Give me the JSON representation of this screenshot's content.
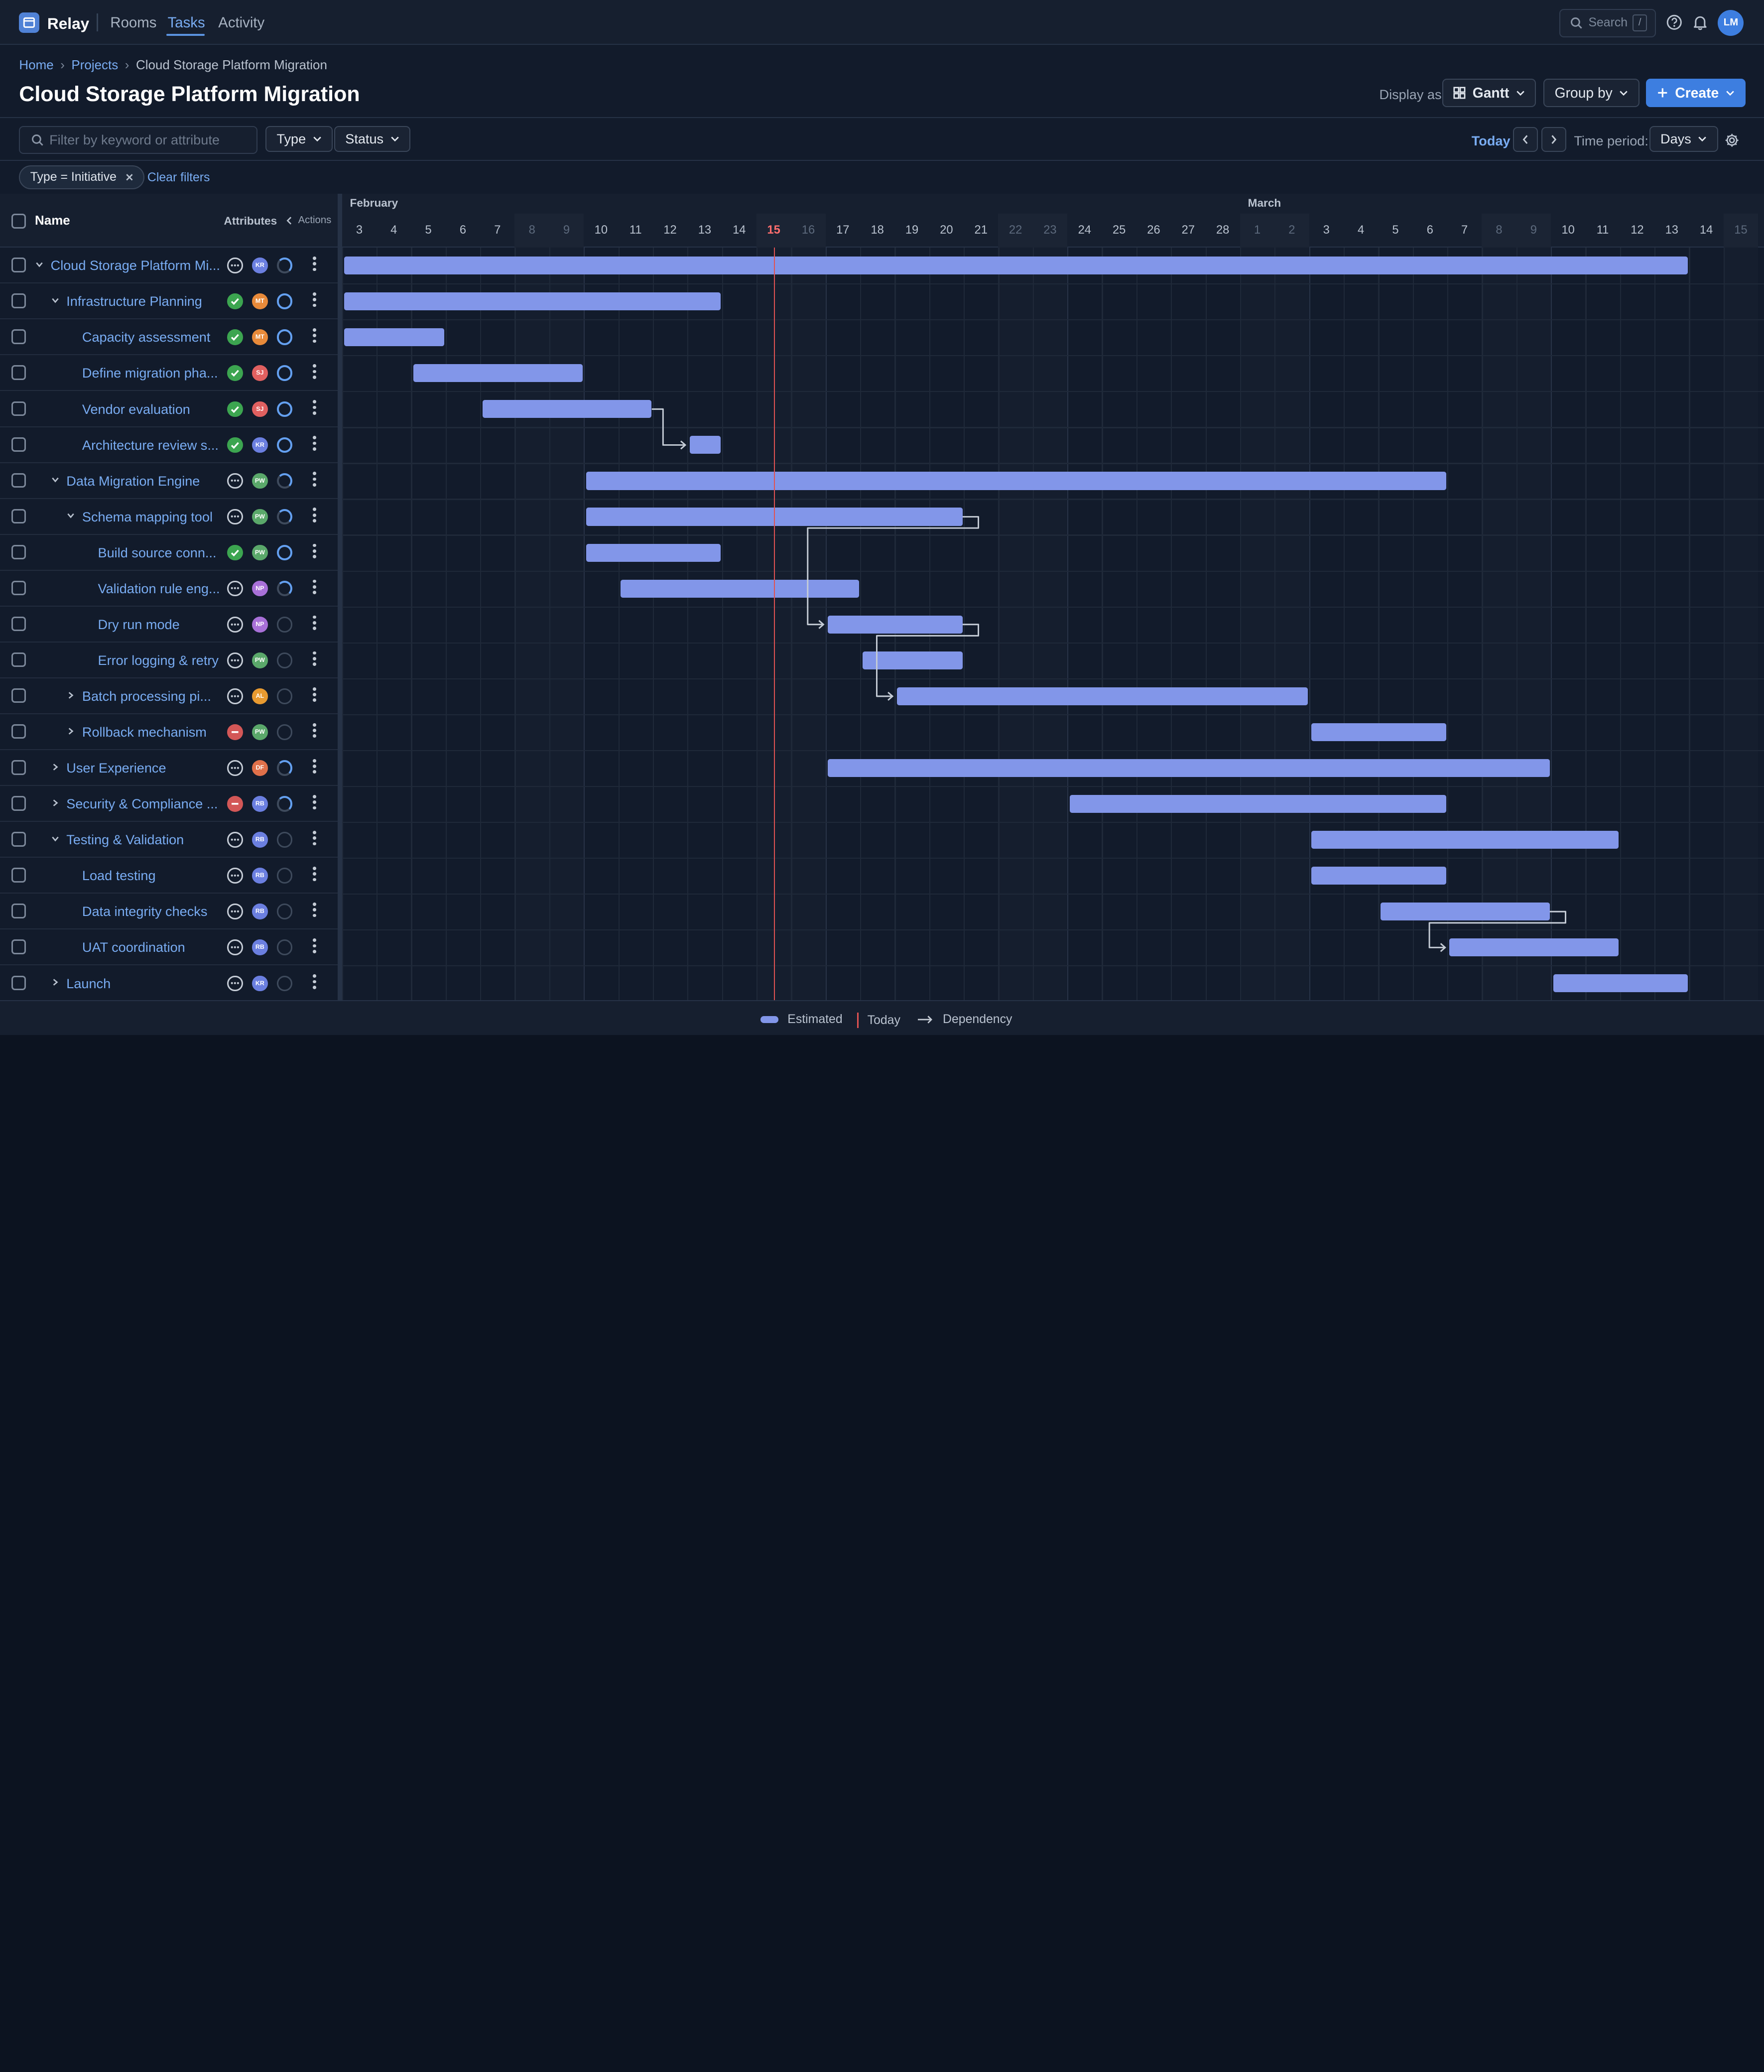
{
  "app": {
    "name": "Relay",
    "brand_color": "#3d7ee0"
  },
  "nav": {
    "tabs": [
      {
        "label": "Rooms"
      },
      {
        "label": "Tasks",
        "active": true
      },
      {
        "label": "Activity"
      }
    ]
  },
  "header": {
    "search_placeholder": "Search",
    "search_shortcut": "/",
    "user_initials": "LM"
  },
  "breadcrumb": {
    "items": [
      "Home",
      "Projects",
      "Cloud Storage Platform Migration"
    ]
  },
  "page": {
    "title": "Cloud Storage Platform Migration",
    "display_as_label": "Display as",
    "display_mode": "Gantt",
    "group_by_label": "Group by",
    "create_label": "Create"
  },
  "toolbar": {
    "filter_placeholder": "Filter by keyword or attribute",
    "type_label": "Type",
    "status_label": "Status",
    "today_label": "Today",
    "time_period_label": "Time period:",
    "time_period_value": "Days"
  },
  "filters": {
    "chip_label": "Type = Initiative",
    "clear_label": "Clear filters"
  },
  "columns": {
    "name": "Name",
    "attributes": "Attributes",
    "actions": "Actions"
  },
  "timeline": {
    "months": [
      {
        "label": "February"
      },
      {
        "label": "March"
      }
    ],
    "days": [
      {
        "label": "3"
      },
      {
        "label": "4"
      },
      {
        "label": "5"
      },
      {
        "label": "6"
      },
      {
        "label": "7"
      },
      {
        "label": "8",
        "weekend": true
      },
      {
        "label": "9",
        "weekend": true
      },
      {
        "label": "10"
      },
      {
        "label": "11"
      },
      {
        "label": "12"
      },
      {
        "label": "13"
      },
      {
        "label": "14"
      },
      {
        "label": "15",
        "weekend": true,
        "today": true
      },
      {
        "label": "16",
        "weekend": true
      },
      {
        "label": "17"
      },
      {
        "label": "18"
      },
      {
        "label": "19"
      },
      {
        "label": "20"
      },
      {
        "label": "21"
      },
      {
        "label": "22",
        "weekend": true
      },
      {
        "label": "23",
        "weekend": true
      },
      {
        "label": "24"
      },
      {
        "label": "25"
      },
      {
        "label": "26"
      },
      {
        "label": "27"
      },
      {
        "label": "28"
      },
      {
        "label": "1",
        "weekend": true
      },
      {
        "label": "2",
        "weekend": true
      },
      {
        "label": "3"
      },
      {
        "label": "4"
      },
      {
        "label": "5"
      },
      {
        "label": "6"
      },
      {
        "label": "7"
      },
      {
        "label": "8",
        "weekend": true
      },
      {
        "label": "9",
        "weekend": true
      },
      {
        "label": "10"
      },
      {
        "label": "11"
      },
      {
        "label": "12"
      },
      {
        "label": "13"
      },
      {
        "label": "14"
      },
      {
        "label": "15",
        "weekend": true
      }
    ],
    "today_index": 12
  },
  "avatar_colors": {
    "KR": "#6b7fe0",
    "MT": "#e88a3a",
    "SJ": "#e06060",
    "PW": "#5aa86a",
    "NP": "#a870d8",
    "AL": "#e89a30",
    "DF": "#e0704a",
    "RB": "#6b7fe0"
  },
  "tasks": [
    {
      "name": "Cloud Storage Platform Mi...",
      "level": 0,
      "expand": "open",
      "status": "pending",
      "avatar": "KR",
      "progress": "half",
      "start": 0,
      "end": 38.9
    },
    {
      "name": "Infrastructure Planning",
      "level": 1,
      "expand": "open",
      "status": "done",
      "avatar": "MT",
      "progress": "ring",
      "start": 0,
      "end": 10.9
    },
    {
      "name": "Capacity assessment",
      "level": 2,
      "expand": "none",
      "status": "done",
      "avatar": "MT",
      "progress": "ring",
      "start": 0,
      "end": 2.9
    },
    {
      "name": "Define migration pha...",
      "level": 2,
      "expand": "none",
      "status": "done",
      "avatar": "SJ",
      "progress": "ring",
      "start": 2,
      "end": 6.9
    },
    {
      "name": "Vendor evaluation",
      "level": 2,
      "expand": "none",
      "status": "done",
      "avatar": "SJ",
      "progress": "ring",
      "start": 4,
      "end": 8.9
    },
    {
      "name": "Architecture review s...",
      "level": 2,
      "expand": "none",
      "status": "done",
      "avatar": "KR",
      "progress": "ring",
      "start": 10,
      "end": 10.9
    },
    {
      "name": "Data Migration Engine",
      "level": 1,
      "expand": "open",
      "status": "pending",
      "avatar": "PW",
      "progress": "half",
      "start": 7,
      "end": 31.9
    },
    {
      "name": "Schema mapping tool",
      "level": 2,
      "expand": "open",
      "status": "pending",
      "avatar": "PW",
      "progress": "half",
      "start": 7,
      "end": 17.9
    },
    {
      "name": "Build source conn...",
      "level": 3,
      "expand": "none",
      "status": "done",
      "avatar": "PW",
      "progress": "ring",
      "start": 7,
      "end": 10.9
    },
    {
      "name": "Validation rule eng...",
      "level": 3,
      "expand": "none",
      "status": "pending",
      "avatar": "NP",
      "progress": "half",
      "start": 8,
      "end": 14.9
    },
    {
      "name": "Dry run mode",
      "level": 3,
      "expand": "none",
      "status": "pending",
      "avatar": "NP",
      "progress": "empty",
      "start": 14,
      "end": 17.9
    },
    {
      "name": "Error logging & retry",
      "level": 3,
      "expand": "none",
      "status": "pending",
      "avatar": "PW",
      "progress": "empty",
      "start": 15,
      "end": 17.9
    },
    {
      "name": "Batch processing pi...",
      "level": 2,
      "expand": "closed",
      "status": "pending",
      "avatar": "AL",
      "progress": "empty",
      "start": 16,
      "end": 27.9
    },
    {
      "name": "Rollback mechanism",
      "level": 2,
      "expand": "closed",
      "status": "blocked",
      "avatar": "PW",
      "progress": "empty",
      "start": 28,
      "end": 31.9
    },
    {
      "name": "User Experience",
      "level": 1,
      "expand": "closed",
      "status": "pending",
      "avatar": "DF",
      "progress": "half",
      "start": 14,
      "end": 34.9
    },
    {
      "name": "Security & Compliance ...",
      "level": 1,
      "expand": "closed",
      "status": "blocked",
      "avatar": "RB",
      "progress": "half",
      "start": 21,
      "end": 31.9
    },
    {
      "name": "Testing & Validation",
      "level": 1,
      "expand": "open",
      "status": "pending",
      "avatar": "RB",
      "progress": "empty",
      "start": 28,
      "end": 36.9
    },
    {
      "name": "Load testing",
      "level": 2,
      "expand": "none",
      "status": "pending",
      "avatar": "RB",
      "progress": "empty",
      "start": 28,
      "end": 31.9
    },
    {
      "name": "Data integrity checks",
      "level": 2,
      "expand": "none",
      "status": "pending",
      "avatar": "RB",
      "progress": "empty",
      "start": 30,
      "end": 34.9
    },
    {
      "name": "UAT coordination",
      "level": 2,
      "expand": "none",
      "status": "pending",
      "avatar": "RB",
      "progress": "empty",
      "start": 32,
      "end": 36.9
    },
    {
      "name": "Launch",
      "level": 1,
      "expand": "closed",
      "status": "pending",
      "avatar": "KR",
      "progress": "empty",
      "start": 35,
      "end": 38.9
    }
  ],
  "dependencies": [
    {
      "from": 4,
      "to": 5
    },
    {
      "from": 7,
      "to": 10
    },
    {
      "from": 10,
      "to": 12
    },
    {
      "from": 18,
      "to": 19
    }
  ],
  "legend": {
    "estimated": "Estimated",
    "today": "Today",
    "dependency": "Dependency"
  }
}
